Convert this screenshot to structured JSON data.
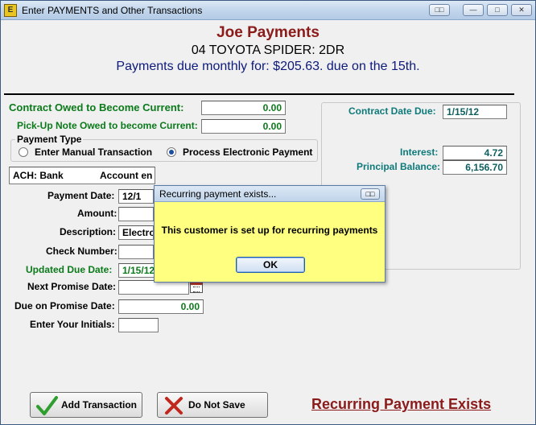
{
  "window": {
    "title": "Enter PAYMENTS and Other Transactions",
    "app_icon": "E"
  },
  "header": {
    "customer_name": "Joe Payments",
    "vehicle": "04 TOYOTA SPIDER: 2DR",
    "payment_terms": "Payments due monthly for: $205.63. due on the 15th."
  },
  "contract": {
    "owed_label": "Contract Owed to Become Current:",
    "owed_value": "0.00",
    "pickup_label": "Pick-Up Note Owed to become Current:",
    "pickup_value": "0.00"
  },
  "payment_type": {
    "group_label": "Payment Type",
    "option_manual": "Enter Manual Transaction",
    "option_electronic": "Process Electronic Payment",
    "selected": "electronic"
  },
  "ach": {
    "bank_label": "ACH: Bank",
    "account_label": "Account en"
  },
  "form": {
    "payment_date_label": "Payment Date:",
    "payment_date_value": "12/1",
    "amount_label": "Amount:",
    "amount_value": "",
    "description_label": "Description:",
    "description_value": "Electro",
    "check_label": "Check Number:",
    "check_value": "",
    "updated_due_label": "Updated Due Date:",
    "updated_due_value": "1/15/12",
    "next_promise_label": "Next Promise Date:",
    "next_promise_value": "",
    "due_promise_label": "Due on Promise Date:",
    "due_promise_value": "0.00",
    "initials_label": "Enter Your Initials:",
    "initials_value": ""
  },
  "right_panel": {
    "contract_due_label": "Contract Date Due:",
    "contract_due_value": "1/15/12",
    "interest_label": "Interest:",
    "interest_value": "4.72",
    "principal_label": "Principal Balance:",
    "principal_value": "6,156.70"
  },
  "buttons": {
    "add": "Add Transaction",
    "cancel": "Do Not Save"
  },
  "status": {
    "recurring": "Recurring Payment Exists"
  },
  "dialog": {
    "title": "Recurring payment exists...",
    "message": "This customer is set up for recurring payments",
    "ok": "OK"
  },
  "colors": {
    "header_red": "#8b1a1a",
    "label_green": "#0b7a1a",
    "label_teal": "#0f7a7a",
    "dialog_bg": "#ffff80"
  }
}
